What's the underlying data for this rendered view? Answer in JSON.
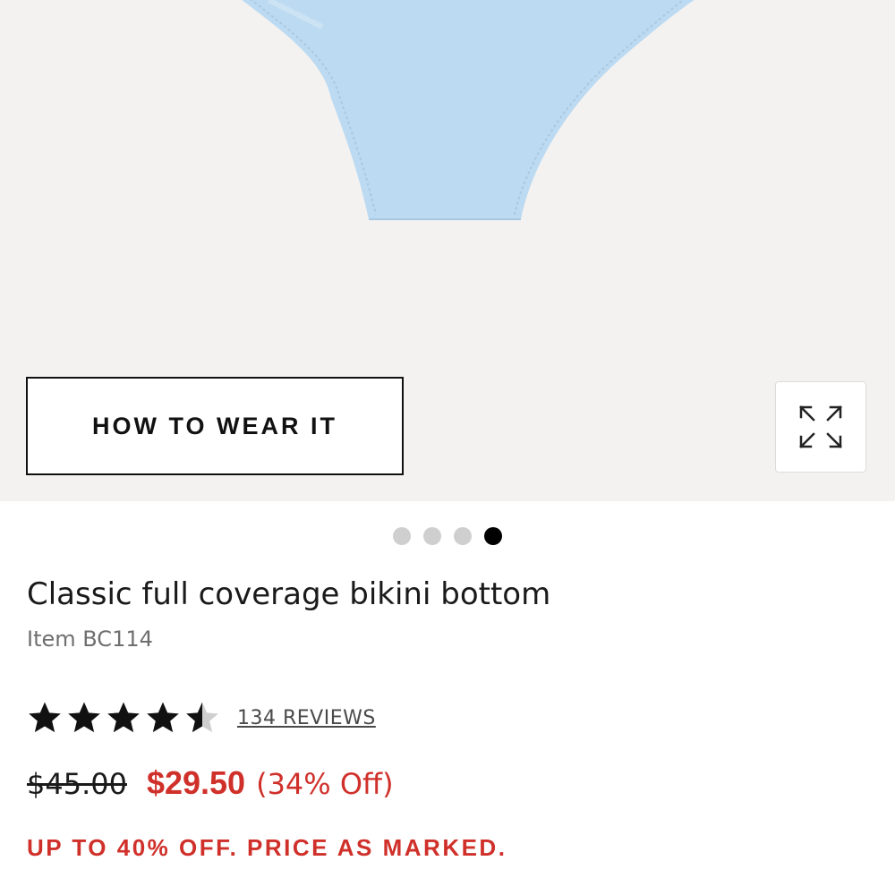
{
  "gallery": {
    "how_to_wear_label": "HOW TO WEAR IT",
    "expand_icon": "expand-arrows-icon",
    "dots": [
      {
        "active": false
      },
      {
        "active": false
      },
      {
        "active": false
      },
      {
        "active": true
      }
    ],
    "product_color": "#bcdaf1"
  },
  "product": {
    "title": "Classic full coverage bikini bottom",
    "item_number": "Item BC114",
    "rating": 4.5,
    "rating_max": 5,
    "reviews_label": "134 REVIEWS",
    "original_price": "$45.00",
    "sale_price": "$29.50",
    "discount": "(34% Off)",
    "promo": "UP TO 40% OFF. PRICE AS MARKED."
  },
  "colors": {
    "sale_red": "#d0302a",
    "text_dark": "#1a1a1a",
    "text_muted": "#6f6f6f",
    "gallery_bg": "#f3f2f1"
  }
}
